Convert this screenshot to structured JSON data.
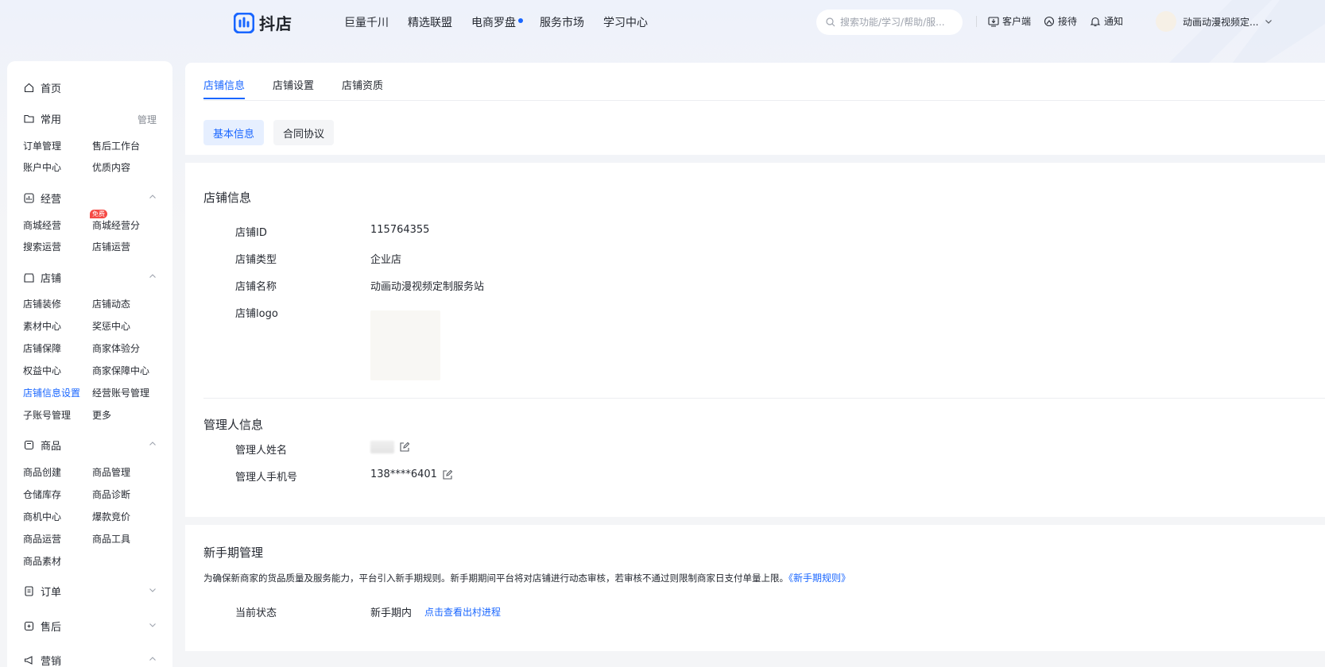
{
  "header": {
    "logo_text": "抖店",
    "nav": [
      "巨量千川",
      "精选联盟",
      "电商罗盘",
      "服务市场",
      "学习中心"
    ],
    "search_placeholder": "搜索功能/学习/帮助/服...",
    "tools": {
      "client": "客户端",
      "reception": "接待",
      "notify": "通知"
    },
    "username": "动画动漫视频定..."
  },
  "sidebar": {
    "home": "首页",
    "groups": {
      "common": {
        "label": "常用",
        "action": "管理",
        "items": [
          "订单管理",
          "售后工作台",
          "账户中心",
          "优质内容"
        ]
      },
      "operation": {
        "label": "经营",
        "items": [
          "商城经营",
          "商城经营分",
          "搜索运营",
          "店铺运营"
        ],
        "badge": "免费"
      },
      "shop": {
        "label": "店铺",
        "items": [
          "店铺装修",
          "店铺动态",
          "素材中心",
          "奖惩中心",
          "店铺保障",
          "商家体验分",
          "权益中心",
          "商家保障中心",
          "店铺信息设置",
          "经营账号管理",
          "子账号管理",
          "更多"
        ]
      },
      "goods": {
        "label": "商品",
        "items": [
          "商品创建",
          "商品管理",
          "仓储库存",
          "商品诊断",
          "商机中心",
          "爆款竞价",
          "商品运营",
          "商品工具",
          "商品素材"
        ]
      },
      "order": {
        "label": "订单"
      },
      "aftersale": {
        "label": "售后"
      },
      "marketing": {
        "label": "营销"
      }
    }
  },
  "tabs": [
    "店铺信息",
    "店铺设置",
    "店铺资质"
  ],
  "subtabs": [
    "基本信息",
    "合同协议"
  ],
  "shop_info": {
    "title": "店铺信息",
    "rows": {
      "id": {
        "label": "店铺ID",
        "value": "115764355"
      },
      "type": {
        "label": "店铺类型",
        "value": "企业店"
      },
      "name": {
        "label": "店铺名称",
        "value": "动画动漫视频定制服务站"
      },
      "logo": {
        "label": "店铺logo"
      }
    }
  },
  "manager_info": {
    "title": "管理人信息",
    "name_label": "管理人姓名",
    "phone_label": "管理人手机号",
    "phone_value": "138****6401"
  },
  "newbie": {
    "title": "新手期管理",
    "description": "为确保新商家的货品质量及服务能力，平台引入新手期规则。新手期期间平台将对店铺进行动态审核，若审核不通过则限制商家日支付单量上限。",
    "rule_link": "《新手期规则》",
    "status_label": "当前状态",
    "status_value": "新手期内",
    "progress_link": "点击查看出村进程"
  },
  "colors": {
    "accent": "#1966ff",
    "badge": "#f54a45",
    "text": "#252931"
  }
}
